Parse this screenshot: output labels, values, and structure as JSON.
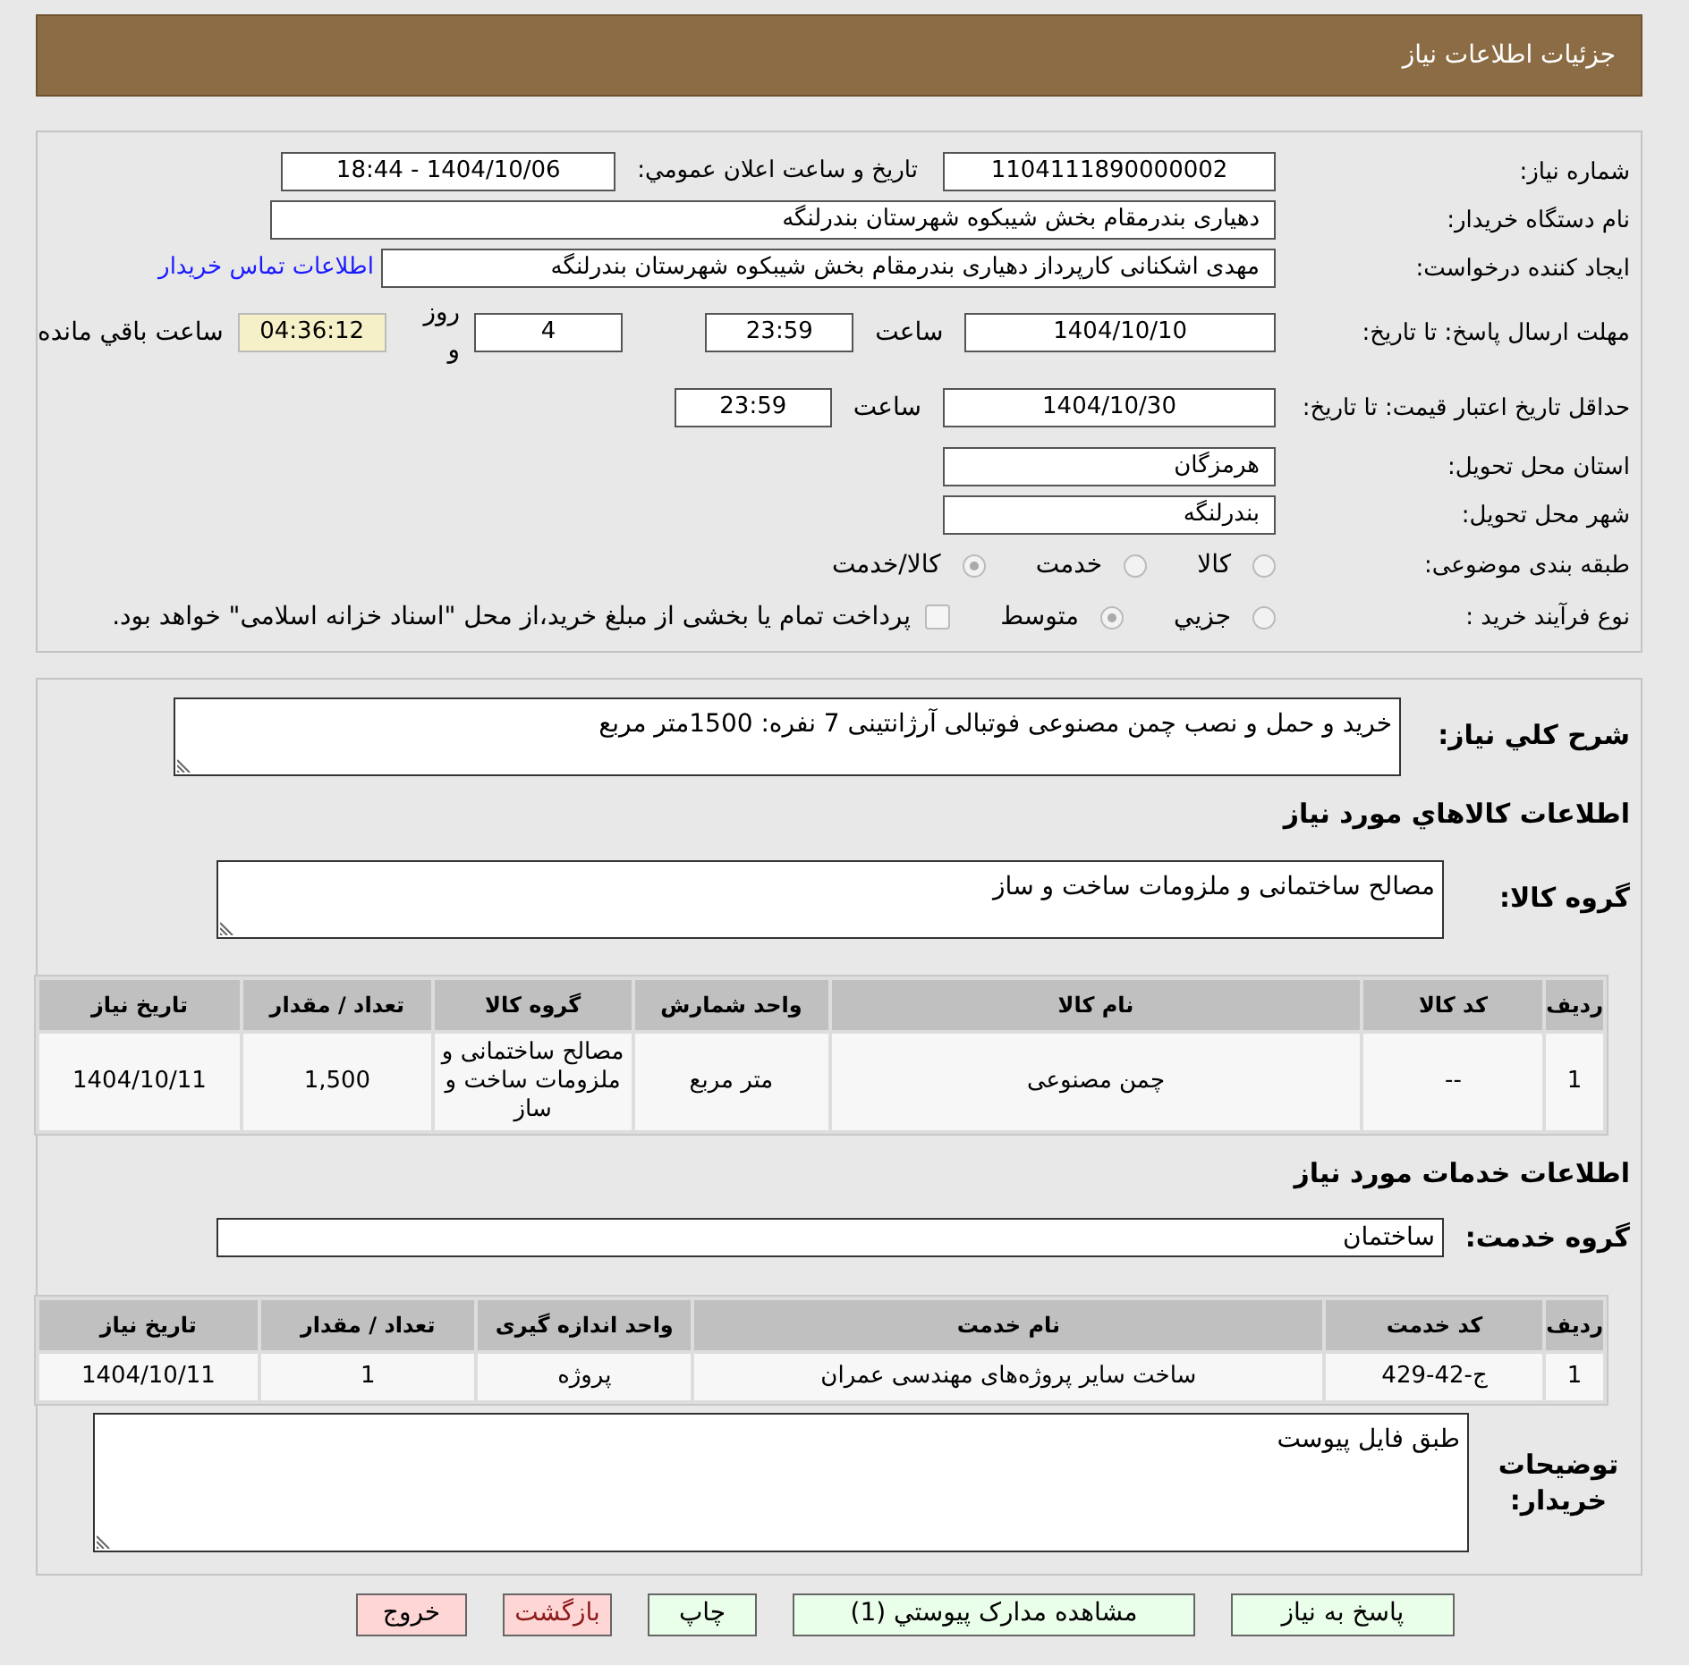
{
  "header": {
    "title": "جزئیات اطلاعات نیاز"
  },
  "details": {
    "need_number": {
      "label": "شماره نیاز:",
      "value": "1104111890000002"
    },
    "announce": {
      "label": "تاریخ و ساعت اعلان عمومي:",
      "value": "1404/10/06 - 18:44"
    },
    "buyer_org": {
      "label": "نام دستگاه خریدار:",
      "value": "دهیاری بندرمقام بخش شیبکوه شهرستان بندرلنگه"
    },
    "requester": {
      "label": "ایجاد کننده درخواست:",
      "value": "مهدی اشکنانی کارپرداز دهیاری بندرمقام بخش شیبکوه شهرستان بندرلنگه",
      "link": "اطلاعات تماس خریدار"
    },
    "deadline": {
      "label": "مهلت ارسال پاسخ: تا تاریخ:",
      "date": "1404/10/10",
      "time_label": "ساعت",
      "time": "23:59",
      "days": "4",
      "days_label": "روز و",
      "remaining": "04:36:12",
      "remaining_label": "ساعت باقي مانده"
    },
    "validity": {
      "label": "حداقل تاریخ اعتبار قیمت: تا تاریخ:",
      "date": "1404/10/30",
      "time_label": "ساعت",
      "time": "23:59"
    },
    "province": {
      "label": "استان محل تحویل:",
      "value": "هرمزگان"
    },
    "city": {
      "label": "شهر محل تحویل:",
      "value": "بندرلنگه"
    },
    "category": {
      "label": "طبقه بندی موضوعی:",
      "options": [
        {
          "label": "کالا",
          "selected": false
        },
        {
          "label": "خدمت",
          "selected": false
        },
        {
          "label": "کالا/خدمت",
          "selected": true
        }
      ]
    },
    "process": {
      "label": "نوع فرآیند خرید :",
      "options": [
        {
          "label": "جزيي",
          "selected": false
        },
        {
          "label": "متوسط",
          "selected": true
        }
      ],
      "treasury": {
        "checked": false,
        "text": "پرداخت تمام یا بخشی از مبلغ خرید،از محل \"اسناد خزانه اسلامی\" خواهد بود."
      }
    }
  },
  "summary": {
    "label": "شرح کلي نياز:",
    "value": "خرید و حمل و نصب چمن مصنوعی فوتبالی آرژانتینی 7 نفره: 1500متر مربع"
  },
  "goods": {
    "heading": "اطلاعات کالاهاي مورد نياز",
    "group_label": "گروه کالا:",
    "group": "مصالح ساختمانی و ملزومات ساخت و ساز",
    "table": {
      "columns": [
        "ردیف",
        "کد کالا",
        "نام کالا",
        "واحد شمارش",
        "گروه کالا",
        "تعداد / مقدار",
        "تاریخ نیاز"
      ],
      "rows": [
        [
          "1",
          "--",
          "چمن مصنوعی",
          "متر مربع",
          "مصالح ساختمانی و ملزومات ساخت و ساز",
          "1,500",
          "1404/10/11"
        ]
      ]
    }
  },
  "services": {
    "heading": "اطلاعات خدمات مورد نياز",
    "group_label": "گروه خدمت:",
    "group": "ساختمان",
    "table": {
      "columns": [
        "ردیف",
        "کد خدمت",
        "نام خدمت",
        "واحد اندازه گیری",
        "تعداد / مقدار",
        "تاریخ نیاز"
      ],
      "rows": [
        [
          "1",
          "ج-42-429",
          "ساخت سایر پروژه‌های مهندسی عمران",
          "پروژه",
          "1",
          "1404/10/11"
        ]
      ]
    }
  },
  "notes": {
    "label": "توضیحات خریدار:",
    "value": "طبق فایل پیوست"
  },
  "buttons": [
    {
      "label": "پاسخ به نیاز",
      "kind": "primary"
    },
    {
      "label": "مشاهده مدارک پیوستي (1)",
      "kind": "primary"
    },
    {
      "label": "چاپ",
      "kind": "primary"
    },
    {
      "label": "بازگشت",
      "kind": "back"
    },
    {
      "label": "خروج",
      "kind": "exit"
    }
  ]
}
